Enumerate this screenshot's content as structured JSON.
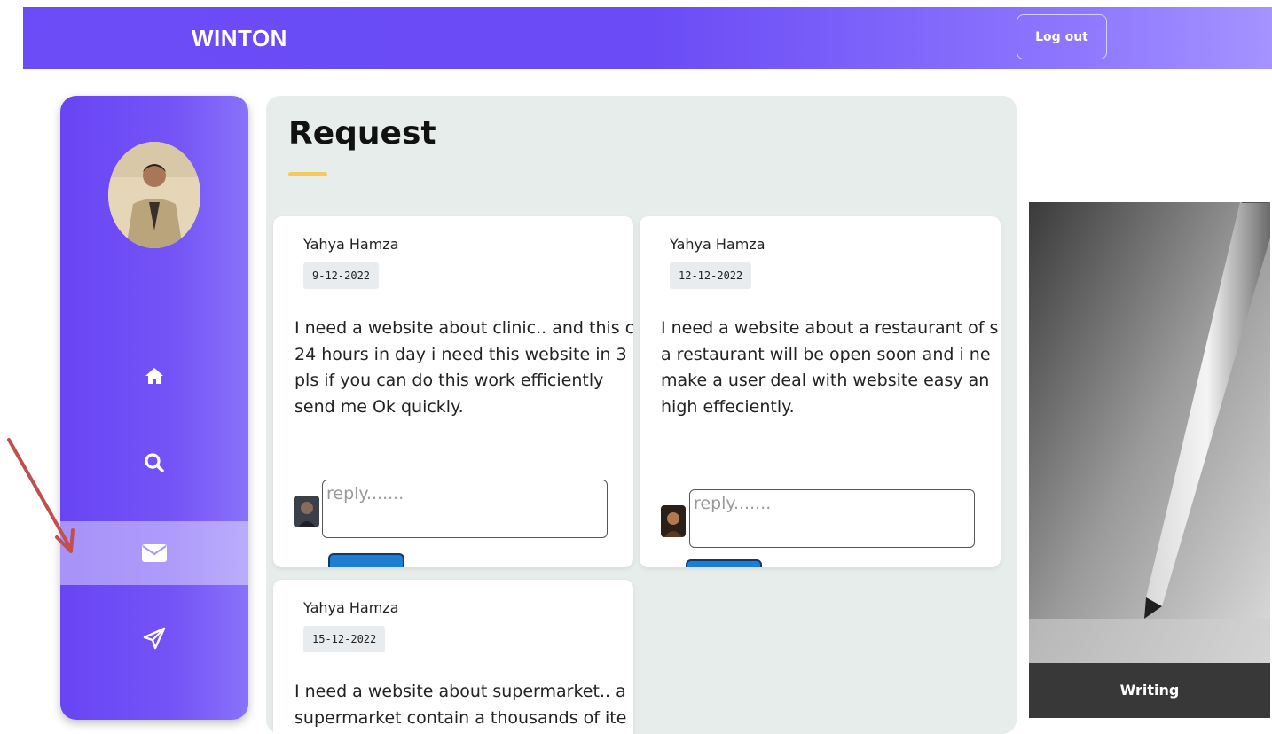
{
  "header": {
    "brand": "WINTON",
    "logout_label": "Log out"
  },
  "sidebar": {
    "items": [
      {
        "icon": "home-icon",
        "active": false
      },
      {
        "icon": "search-icon",
        "active": false
      },
      {
        "icon": "envelope-icon",
        "active": true
      },
      {
        "icon": "paper-plane-icon",
        "active": false
      }
    ]
  },
  "main": {
    "title": "Request",
    "requests": [
      {
        "author": "Yahya Hamza",
        "date": "9-12-2022",
        "message": [
          "I need a website about clinic.. and this c",
          "24 hours in day i need this website in 3",
          "pls if you can do this work efficiently",
          "send me Ok quickly."
        ],
        "reply_placeholder": "reply......."
      },
      {
        "author": "Yahya Hamza",
        "date": "12-12-2022",
        "message": [
          "I need a website about a restaurant of s",
          "a restaurant will be open soon  and i ne",
          "make a user deal with website easy an",
          "high effeciently."
        ],
        "reply_placeholder": "reply......."
      },
      {
        "author": "Yahya Hamza",
        "date": "15-12-2022",
        "message": [
          "I need a website about supermarket.. a",
          "supermarket contain a thousands of ite"
        ]
      }
    ]
  },
  "side_image": {
    "caption": "Writing"
  },
  "colors": {
    "primary": "#6a4bf5",
    "accent": "#f7c95c",
    "reply_button": "#1d7ed3"
  }
}
